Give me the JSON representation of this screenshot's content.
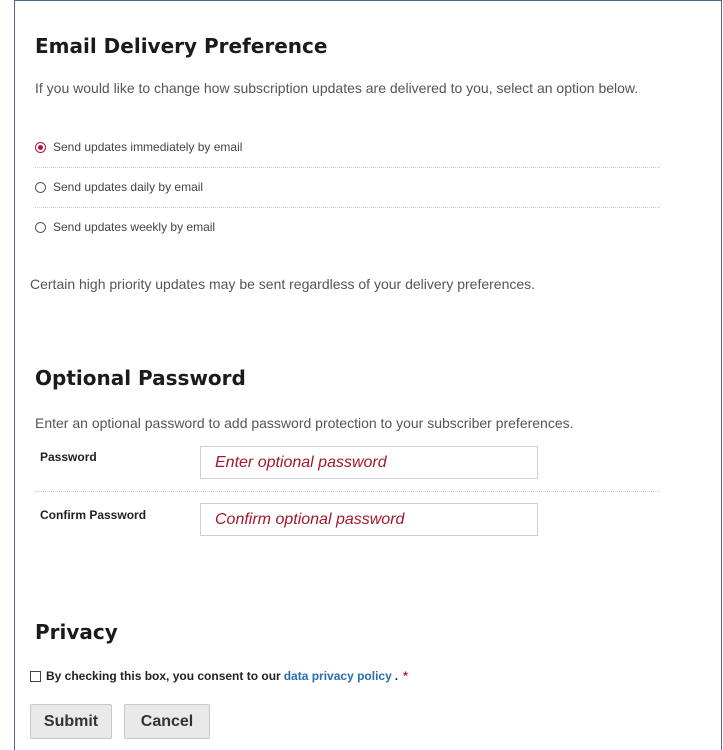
{
  "email_section": {
    "title": "Email Delivery Preference",
    "intro": "If you would like to change how subscription updates are delivered to you, select an option below.",
    "options": [
      {
        "label": "Send updates immediately by email",
        "selected": true
      },
      {
        "label": "Send updates daily by email",
        "selected": false
      },
      {
        "label": "Send updates weekly by email",
        "selected": false
      }
    ],
    "note": "Certain high priority updates may be sent regardless of your delivery preferences."
  },
  "password_section": {
    "title": "Optional Password",
    "intro": "Enter an optional password to add password protection to your subscriber preferences.",
    "password_label": "Password",
    "password_placeholder": "Enter optional password",
    "confirm_label": "Confirm Password",
    "confirm_placeholder": "Confirm optional password"
  },
  "privacy_section": {
    "title": "Privacy",
    "consent_prefix": "By checking this box, you consent to our",
    "policy_link": "data privacy policy",
    "consent_suffix": ".",
    "required_marker": "*",
    "checked": false
  },
  "actions": {
    "submit_label": "Submit",
    "cancel_label": "Cancel"
  },
  "colors": {
    "accent": "#b3133b",
    "link": "#2a6ead",
    "placeholder": "#a3192c"
  }
}
